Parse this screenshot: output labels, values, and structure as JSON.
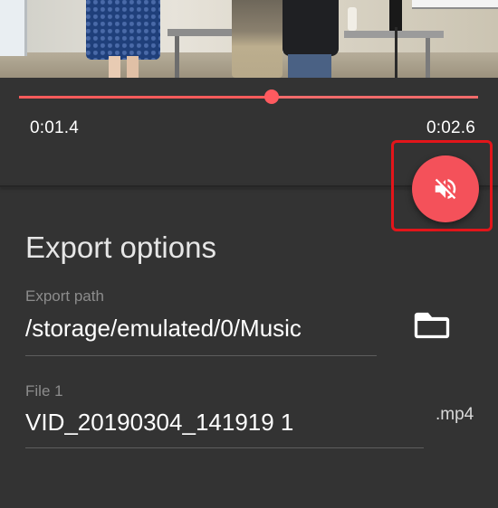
{
  "video": {
    "progress": 0.55
  },
  "timeline": {
    "start_time": "0:01.4",
    "end_time": "0:02.6"
  },
  "mute_button": {
    "icon": "volume-off-icon",
    "color": "#f4515a",
    "highlight_color": "#e3151a"
  },
  "export": {
    "title": "Export options",
    "path_label": "Export path",
    "path_value": "/storage/emulated/0/Music",
    "folder_icon": "folder-icon",
    "file_label": "File 1",
    "file_value": "VID_20190304_141919 1",
    "extension": ".mp4"
  },
  "colors": {
    "accent": "#ff5a5f",
    "background": "#333333"
  }
}
